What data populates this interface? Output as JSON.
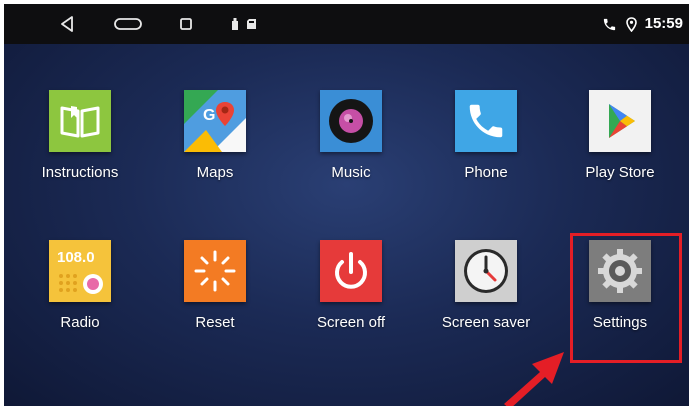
{
  "status_bar": {
    "time": "15:59",
    "nav_icons": [
      "back-icon",
      "home-icon",
      "recents-icon"
    ],
    "notification_icons": [
      "usb-icon",
      "sd-card-icon"
    ],
    "status_icons": [
      "phone-icon",
      "location-icon"
    ]
  },
  "apps": [
    {
      "label": "Instructions",
      "icon": "book-icon",
      "color": "#8dc63f"
    },
    {
      "label": "Maps",
      "icon": "maps-icon",
      "color": "#4f9de0"
    },
    {
      "label": "Music",
      "icon": "music-disc-icon",
      "color": "#3a8ed6"
    },
    {
      "label": "Phone",
      "icon": "phone-handset-icon",
      "color": "#3fa6e6"
    },
    {
      "label": "Play Store",
      "icon": "play-store-icon",
      "color": "#f2f2f2"
    },
    {
      "label": "Radio",
      "icon": "radio-icon",
      "color": "#f5c33b",
      "display": "108.0"
    },
    {
      "label": "Reset",
      "icon": "reset-icon",
      "color": "#f37b23"
    },
    {
      "label": "Screen off",
      "icon": "power-icon",
      "color": "#e63a3a"
    },
    {
      "label": "Screen saver",
      "icon": "clock-icon",
      "color": "#cfcfcf"
    },
    {
      "label": "Settings",
      "icon": "gear-icon",
      "color": "#7d7d7d"
    }
  ],
  "annotation": {
    "highlight_color": "#e41e26",
    "target": "Settings"
  }
}
